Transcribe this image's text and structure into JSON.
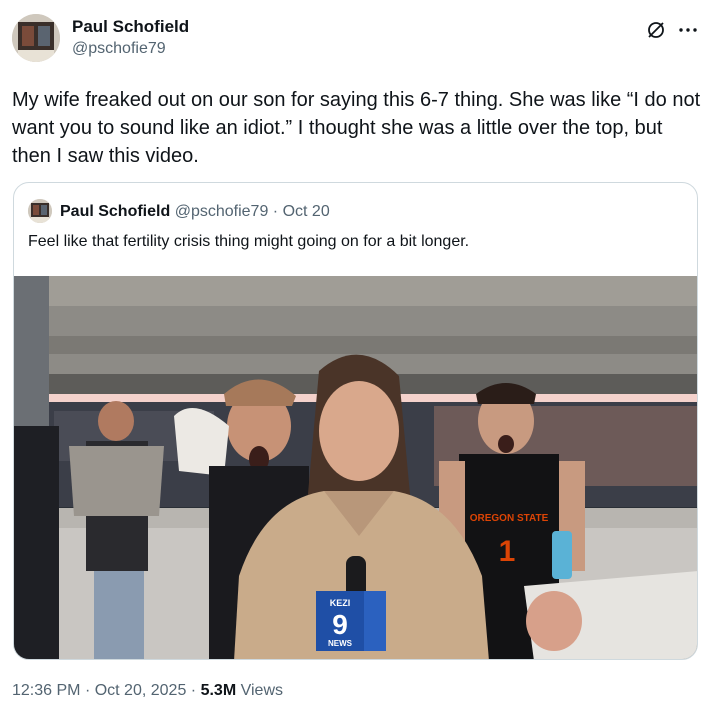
{
  "tweet": {
    "author_name": "Paul Schofield",
    "author_handle": "@pschofie79",
    "text": "My wife freaked out on our son for saying this 6-7 thing. She was like “I do not want you to sound like an idiot.” I thought she was a little over the top, but then I saw this video.",
    "time": "12:36 PM",
    "separator": "·",
    "date": "Oct 20, 2025",
    "views_count": "5.3M",
    "views_label": "Views",
    "icons": [
      "grok-icon",
      "more-icon"
    ]
  },
  "quoted": {
    "author_name": "Paul Schofield",
    "author_handle": "@pschofie79",
    "separator": "·",
    "date": "Oct 20",
    "text": "Feel like that fertility crisis thing might going on for a bit longer.",
    "media": {
      "mic_logo_top": "KEZI",
      "mic_logo_number": "9",
      "mic_logo_bottom": "NEWS",
      "jersey_text": "OREGON STATE",
      "jersey_number": "1"
    }
  },
  "colors": {
    "text_primary": "#0f1419",
    "text_secondary": "#536471",
    "border": "#cfd9de",
    "jersey_orange": "#dc4405"
  }
}
